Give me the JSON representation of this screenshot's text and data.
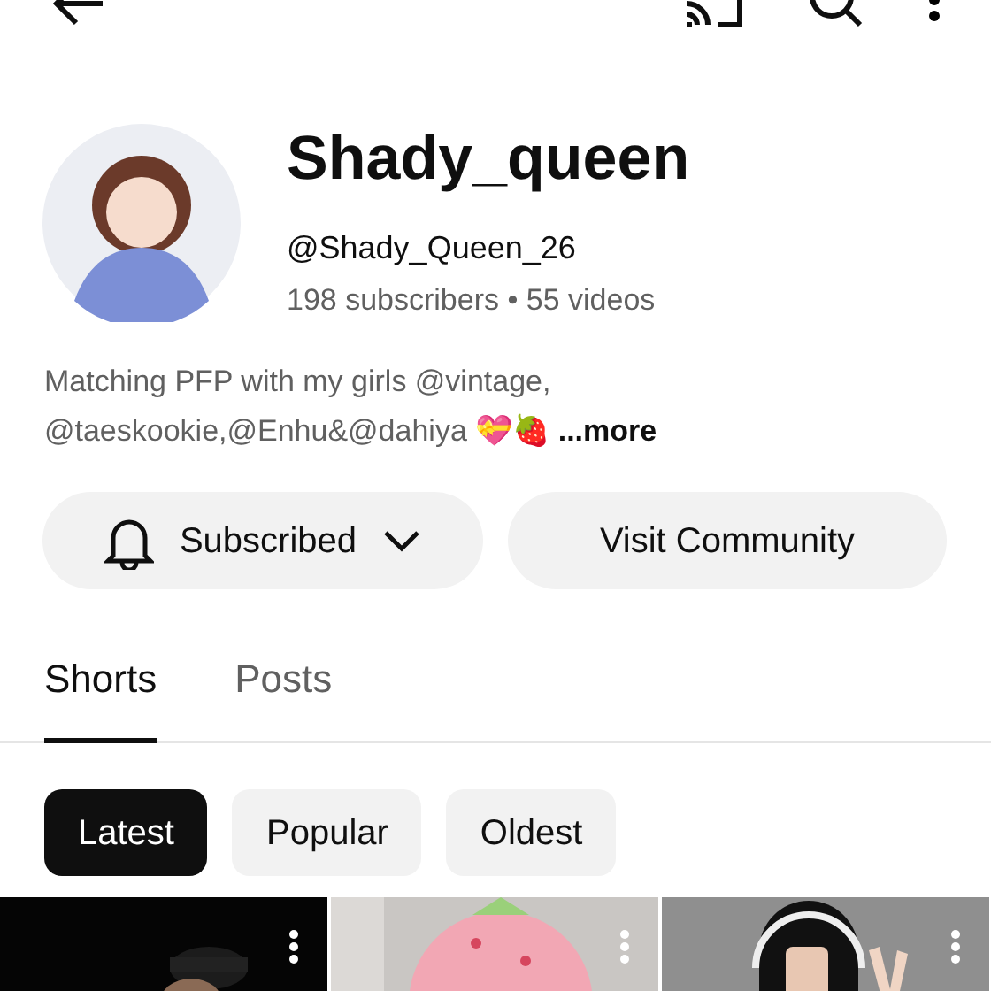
{
  "channel": {
    "name": "Shady_queen",
    "handle": "@Shady_Queen_26",
    "stats": "198 subscribers • 55 videos",
    "description": "Matching PFP with my girls @vintage, @taeskookie,@Enhu&@dahiya 💝🍓",
    "more": "...more"
  },
  "buttons": [
    {
      "kind": "subscribed",
      "label": "Subscribed"
    },
    {
      "kind": "plain",
      "label": "Visit Community"
    }
  ],
  "tabs": [
    {
      "label": "Shorts",
      "selected": true
    },
    {
      "label": "Posts",
      "selected": false
    }
  ],
  "chips": [
    {
      "label": "Latest",
      "selected": true
    },
    {
      "label": "Popular",
      "selected": false
    },
    {
      "label": "Oldest",
      "selected": false
    }
  ]
}
